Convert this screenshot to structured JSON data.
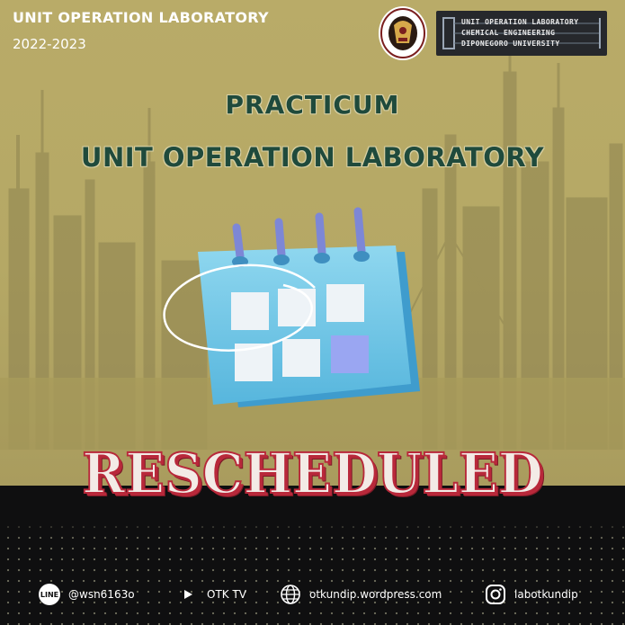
{
  "header": {
    "title": "UNIT OPERATION LABORATORY",
    "year": "2022-2023",
    "lab_logo": {
      "line1": "UNIT OPERATION LABORATORY",
      "line2": "CHEMICAL ENGINEERING",
      "line3": "DIPONEGORO UNIVERSITY"
    },
    "university_seal": {
      "name": "university-seal-icon",
      "text_top": "UNIVERSITAS DIPONEGORO",
      "text_bottom": "SEMARANG"
    }
  },
  "headline": {
    "line1": "PRACTICUM",
    "line2": "UNIT OPERATION LABORATORY"
  },
  "status": "RESCHEDULED",
  "footer": [
    {
      "icon": "line-icon",
      "label": "@wsn6163o"
    },
    {
      "icon": "play-icon",
      "label": "OTK TV"
    },
    {
      "icon": "globe-icon",
      "label": "otkundip.wordpress.com"
    },
    {
      "icon": "instagram-icon",
      "label": "labotkundip"
    }
  ],
  "colors": {
    "background": "#b8aa6a",
    "headline": "#1f4a3c",
    "status_fill": "#f3ebe6",
    "status_outline": "#b8283a",
    "band": "#0f0f10"
  }
}
